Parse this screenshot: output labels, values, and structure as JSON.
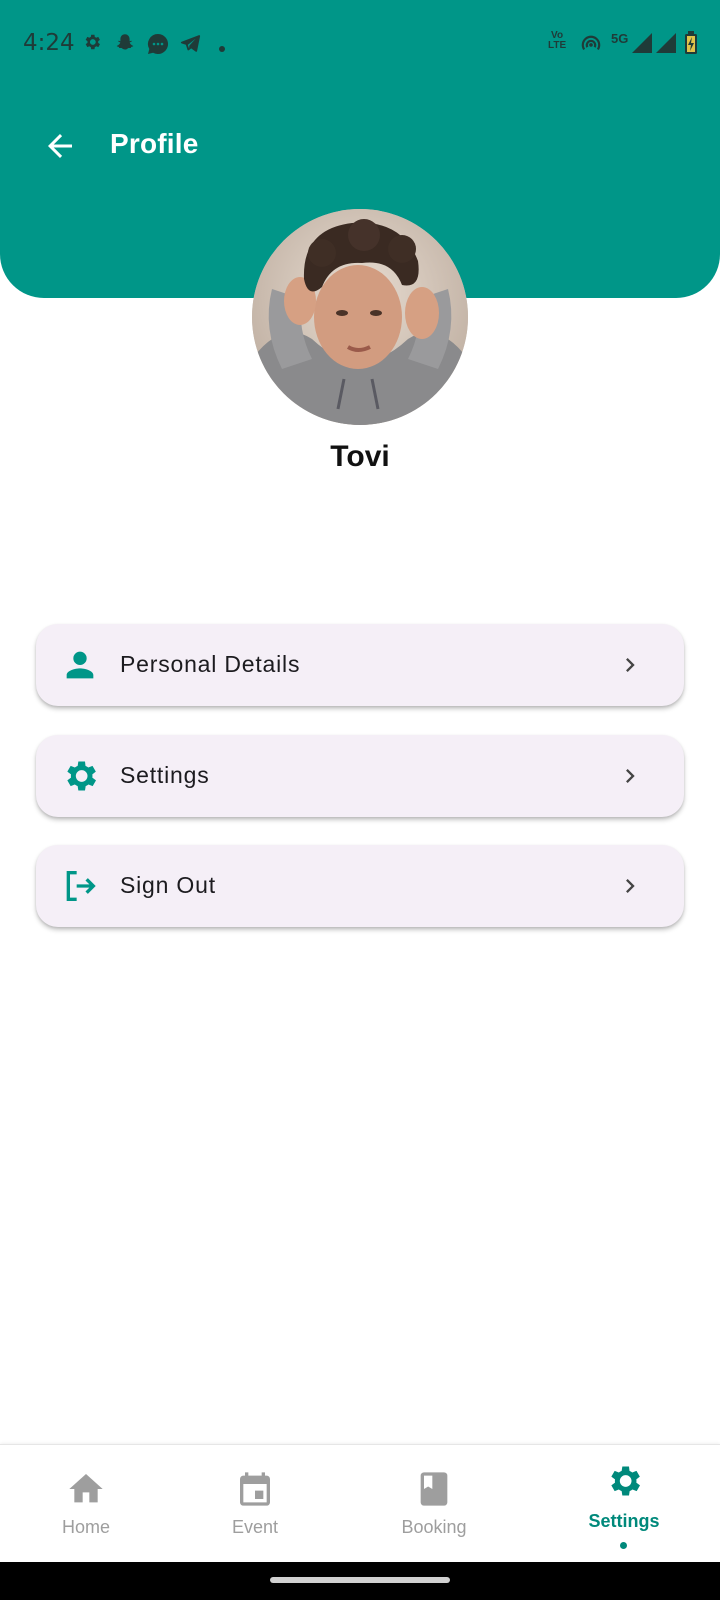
{
  "status_bar": {
    "time": "4:24",
    "left_icons": [
      "gear-icon",
      "snapchat-icon",
      "messages-icon",
      "telegram-icon",
      "dot-icon"
    ],
    "right_icons": [
      "volte-icon",
      "hotspot-icon",
      "signal-5g-icon",
      "signal-icon",
      "battery-charging-icon"
    ],
    "network_label": "5G",
    "volte_label_1": "Vo",
    "volte_label_2": "LTE"
  },
  "app_bar": {
    "title": "Profile",
    "back_icon": "arrow-back-icon"
  },
  "profile": {
    "name": "Tovi"
  },
  "menu": [
    {
      "label": "Personal Details",
      "icon": "person-icon"
    },
    {
      "label": "Settings",
      "icon": "gear-icon"
    },
    {
      "label": "Sign Out",
      "icon": "logout-icon"
    }
  ],
  "bottom_nav": [
    {
      "label": "Home",
      "icon": "home-icon",
      "active": false
    },
    {
      "label": "Event",
      "icon": "calendar-icon",
      "active": false
    },
    {
      "label": "Booking",
      "icon": "book-icon",
      "active": false
    },
    {
      "label": "Settings",
      "icon": "gear-icon",
      "active": true
    }
  ],
  "colors": {
    "primary": "#009688",
    "active_nav": "#00897b",
    "card_background": "#f5eff7",
    "inactive_nav": "#9e9e9e"
  }
}
